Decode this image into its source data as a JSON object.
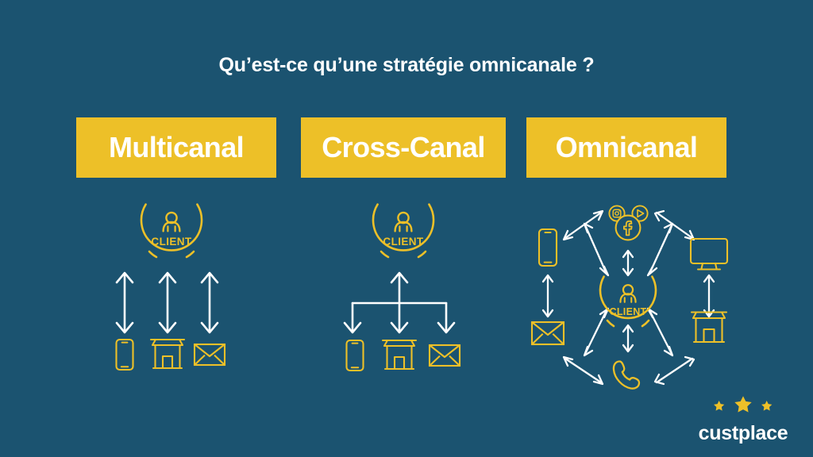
{
  "slide": {
    "background_color": "#1b5370",
    "accent_yellow": "#edc028",
    "arrow_white": "#ffffff",
    "title": "Qu’est-ce qu’une stratégie omnicanale ?"
  },
  "columns": [
    {
      "key": "multicanal",
      "heading": "Multicanal",
      "client_label": "CLIENT",
      "diagram": "parallel-independent-arrows",
      "channels": [
        "mobile-phone",
        "store",
        "email"
      ]
    },
    {
      "key": "cross-canal",
      "heading": "Cross-Canal",
      "client_label": "CLIENT",
      "diagram": "tree-branching-arrows",
      "channels": [
        "mobile-phone",
        "store",
        "email"
      ]
    },
    {
      "key": "omnicanal",
      "heading": "Omnicanal",
      "client_label": "CLIENT",
      "diagram": "hub-and-spoke-hexagon",
      "channels": [
        "mobile-phone",
        "social-media",
        "desktop-monitor",
        "store",
        "telephone",
        "email"
      ]
    }
  ],
  "logo": {
    "name": "custplace",
    "stars": 3,
    "star_color": "#edc028",
    "text_color": "#ffffff"
  }
}
